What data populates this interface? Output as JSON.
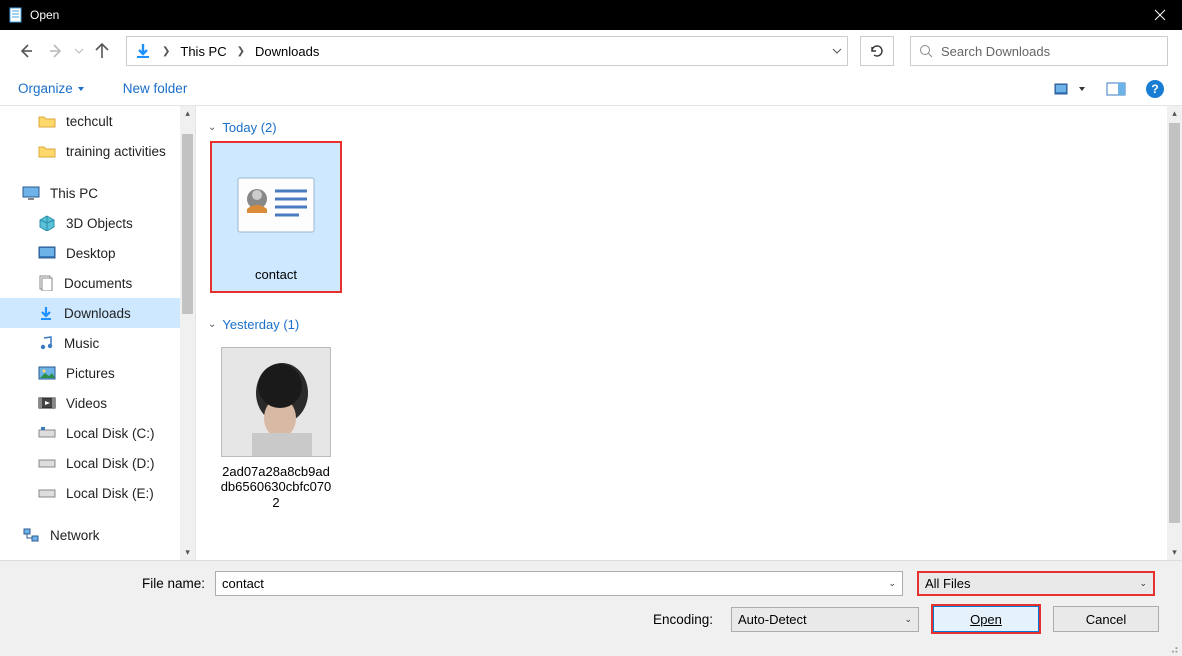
{
  "titlebar": {
    "title": "Open"
  },
  "breadcrumb": {
    "root": "This PC",
    "current": "Downloads"
  },
  "search": {
    "placeholder": "Search Downloads"
  },
  "toolbar": {
    "organize": "Organize",
    "new_folder": "New folder"
  },
  "sidebar": {
    "folders": [
      {
        "label": "techcult",
        "lvl": 2,
        "type": "folder"
      },
      {
        "label": "training activities",
        "lvl": 2,
        "type": "folder"
      }
    ],
    "this_pc": "This PC",
    "items": [
      {
        "label": "3D Objects",
        "icon": "cube"
      },
      {
        "label": "Desktop",
        "icon": "desktop"
      },
      {
        "label": "Documents",
        "icon": "documents"
      },
      {
        "label": "Downloads",
        "icon": "downloads",
        "selected": true
      },
      {
        "label": "Music",
        "icon": "music"
      },
      {
        "label": "Pictures",
        "icon": "pictures"
      },
      {
        "label": "Videos",
        "icon": "videos"
      },
      {
        "label": "Local Disk (C:)",
        "icon": "disk"
      },
      {
        "label": "Local Disk (D:)",
        "icon": "disk"
      },
      {
        "label": "Local Disk (E:)",
        "icon": "disk"
      }
    ],
    "network": "Network"
  },
  "content": {
    "groups": [
      {
        "title": "Today (2)",
        "items": [
          {
            "label": "contact",
            "type": "contact",
            "selected": true
          }
        ]
      },
      {
        "title": "Yesterday (1)",
        "items": [
          {
            "label": "2ad07a28a8cb9addb6560630cbfc0702",
            "type": "photo"
          }
        ]
      }
    ]
  },
  "footer": {
    "filename_label": "File name:",
    "filename_value": "contact",
    "filetype_value": "All Files",
    "encoding_label": "Encoding:",
    "encoding_value": "Auto-Detect",
    "open": "Open",
    "cancel": "Cancel"
  }
}
